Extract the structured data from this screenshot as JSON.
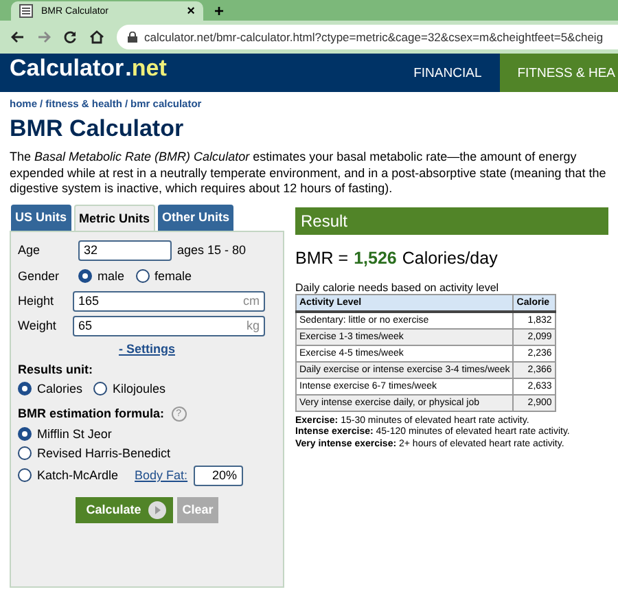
{
  "browser": {
    "tab_title": "BMR Calculator",
    "close": "×",
    "new_tab": "+",
    "url": "calculator.net/bmr-calculator.html?ctype=metric&cage=32&csex=m&cheightfeet=5&cheig"
  },
  "header": {
    "logo_main": "Calculator",
    "logo_dot": ".",
    "logo_tld": "net",
    "nav": [
      {
        "label": "FINANCIAL",
        "selected": false
      },
      {
        "label": "FITNESS & HEA",
        "selected": true
      }
    ]
  },
  "breadcrumb": [
    {
      "label": "home"
    },
    {
      "label": "fitness & health"
    },
    {
      "label": "bmr calculator"
    }
  ],
  "breadcrumb_separator": "/",
  "title": "BMR Calculator",
  "intro": "The *Basal Metabolic Rate (BMR) Calculator* estimates your basal metabolic rate—the amount of energy expended while at rest in a neutrally temperate environment, and in a post-absorptive state (meaning that the digestive system is inactive, which requires about 12 hours of fasting).",
  "unit_tabs": [
    {
      "label": "US Units",
      "selected": false
    },
    {
      "label": "Metric Units",
      "selected": true
    },
    {
      "label": "Other Units",
      "selected": false
    }
  ],
  "form": {
    "age": {
      "label": "Age",
      "value": "32",
      "hint": "ages 15 - 80"
    },
    "gender": {
      "label": "Gender",
      "options": [
        {
          "label": "male",
          "selected": true
        },
        {
          "label": "female",
          "selected": false
        }
      ]
    },
    "height": {
      "label": "Height",
      "value": "165",
      "unit": "cm"
    },
    "weight": {
      "label": "Weight",
      "value": "65",
      "unit": "kg"
    },
    "settings_link": "- Settings",
    "results_unit": {
      "label": "Results unit:",
      "options": [
        {
          "label": "Calories",
          "selected": true
        },
        {
          "label": "Kilojoules",
          "selected": false
        }
      ]
    },
    "formula": {
      "label": "BMR estimation formula:",
      "help": "?",
      "options": [
        {
          "label": "Mifflin St Jeor",
          "selected": true
        },
        {
          "label": "Revised Harris-Benedict",
          "selected": false
        },
        {
          "label": "Katch-McArdle",
          "selected": false
        }
      ]
    },
    "body_fat": {
      "label": "Body Fat:",
      "value": "20",
      "unit": "%"
    },
    "buttons": [
      {
        "label": "Calculate",
        "kind": "primary"
      },
      {
        "label": "Clear",
        "kind": "secondary"
      }
    ]
  },
  "result": {
    "title": "Result",
    "bmr_label": "BMR =",
    "bmr_value": "1,526",
    "bmr_unit": "Calories/day",
    "table_caption": "Daily calorie needs based on activity level",
    "columns": [
      "Activity Level",
      "Calorie"
    ],
    "rows": [
      [
        "Sedentary: little or no exercise",
        "1,832"
      ],
      [
        "Exercise 1-3 times/week",
        "2,099"
      ],
      [
        "Exercise 4-5 times/week",
        "2,236"
      ],
      [
        "Daily exercise or intense exercise 3-4 times/week",
        "2,366"
      ],
      [
        "Intense exercise 6-7 times/week",
        "2,633"
      ],
      [
        "Very intense exercise daily, or physical job",
        "2,900"
      ]
    ],
    "notes": [
      "**Exercise:** 15-30 minutes of elevated heart rate activity.",
      "**Intense exercise:** 45-120 minutes of elevated heart rate activity.",
      "**Very intense exercise:** 2+ hours of elevated heart rate activity."
    ]
  }
}
